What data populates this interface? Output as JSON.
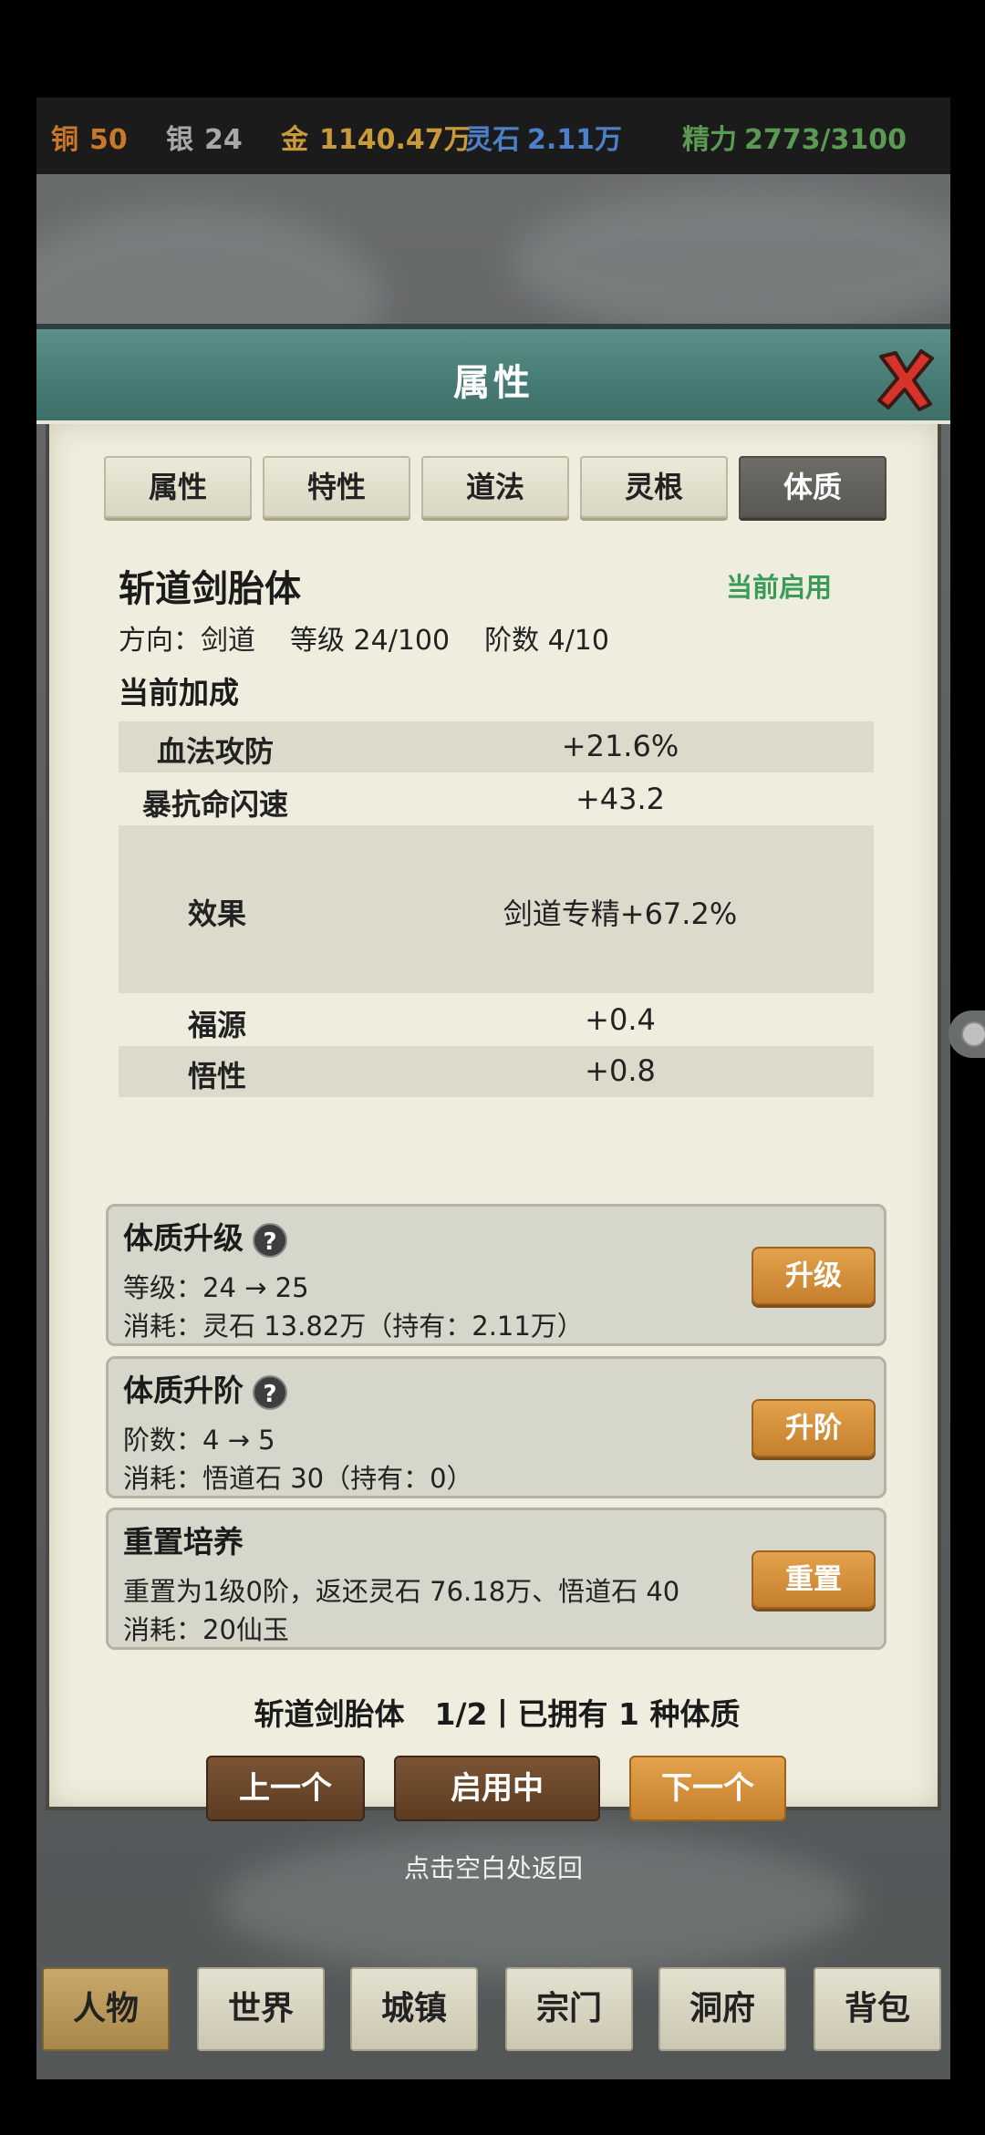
{
  "currency": {
    "copper": {
      "label": "铜",
      "value": "50",
      "color": "#c9772a"
    },
    "silver": {
      "label": "银",
      "value": "24",
      "color": "#a8a8a8"
    },
    "gold": {
      "label": "金",
      "value": "1140.47万",
      "color": "#c99a3a"
    },
    "spirit_stone": {
      "label": "灵石",
      "value": "2.11万",
      "color": "#4e7fc9"
    },
    "energy": {
      "label": "精力",
      "value": "2773/3100",
      "color": "#5a9a52"
    }
  },
  "panel": {
    "title": "属性",
    "close_icon": "close-x-icon"
  },
  "tabs": [
    {
      "label": "属性",
      "active": false
    },
    {
      "label": "特性",
      "active": false
    },
    {
      "label": "道法",
      "active": false
    },
    {
      "label": "灵根",
      "active": false
    },
    {
      "label": "体质",
      "active": true
    }
  ],
  "body": {
    "name": "斩道剑胎体",
    "status": "当前启用",
    "direction": "方向：剑道",
    "level": "等级 24/100",
    "stage": "阶数 4/10",
    "bonus_title": "当前加成"
  },
  "stats": [
    {
      "key": "血法攻防",
      "value": "+21.6%"
    },
    {
      "key": "暴抗命闪速",
      "value": "+43.2"
    },
    {
      "key": "效果",
      "value": "剑道专精+67.2%"
    },
    {
      "key": "福源",
      "value": "+0.4"
    },
    {
      "key": "悟性",
      "value": "+0.8"
    }
  ],
  "cards": {
    "upgrade": {
      "title": "体质升级",
      "line1": "等级：24 → 25",
      "line2": "消耗：灵石 13.82万（持有：2.11万）",
      "button": "升级"
    },
    "ascend": {
      "title": "体质升阶",
      "line1": "阶数：4 → 5",
      "line2": "消耗：悟道石 30（持有：0）",
      "button": "升阶"
    },
    "reset": {
      "title": "重置培养",
      "line1": "重置为1级0阶，返还灵石 76.18万、悟道石 40",
      "line2": "消耗：20仙玉",
      "button": "重置"
    }
  },
  "footer": {
    "summary": "斩道剑胎体　1/2丨已拥有 1 种体质",
    "prev": "上一个",
    "current": "启用中",
    "next": "下一个"
  },
  "hint": "点击空白处返回",
  "bottom_nav": [
    "人物",
    "世界",
    "城镇",
    "宗门",
    "洞府",
    "背包"
  ],
  "help_icon": "?"
}
